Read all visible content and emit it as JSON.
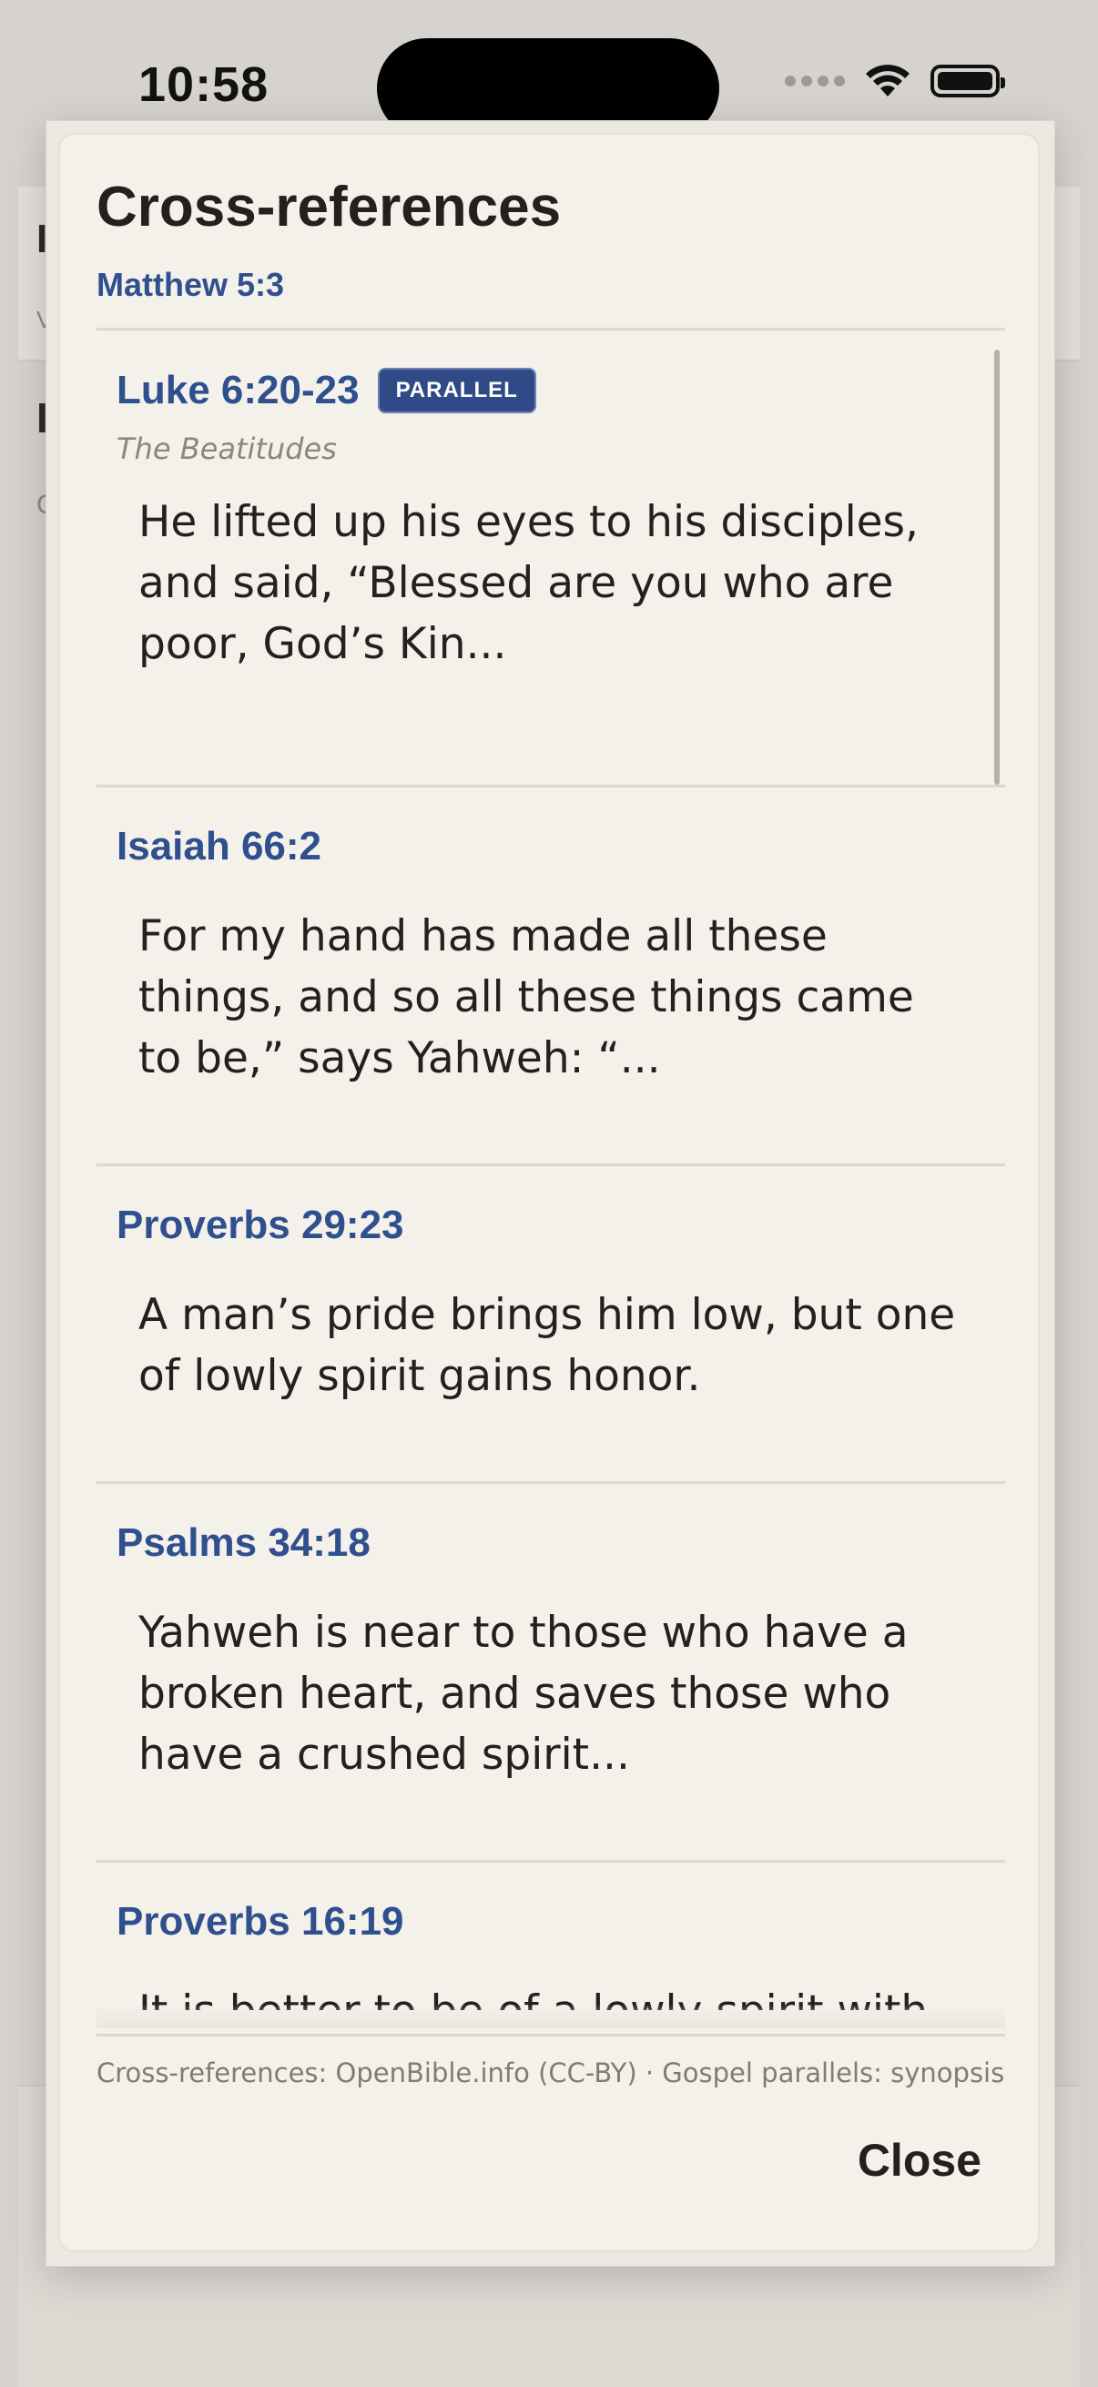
{
  "status_bar": {
    "time": "10:58"
  },
  "background": {
    "fragments": [
      "I",
      "V",
      "I",
      "C"
    ]
  },
  "sheet": {
    "title": "Cross-references",
    "source_reference": "Matthew 5:3",
    "items": [
      {
        "reference": "Luke 6:20-23",
        "badge": "PARALLEL",
        "subtitle": "The Beatitudes",
        "text": "He lifted up his eyes to his disciples, and said, “Blessed are you who are poor, God’s Kin..."
      },
      {
        "reference": "Isaiah 66:2",
        "text": "For my hand has made all these things, and so all these things came to be,” says Yahweh: “..."
      },
      {
        "reference": "Proverbs 29:23",
        "text": "A man’s pride brings him low, but one of lowly spirit gains honor."
      },
      {
        "reference": "Psalms 34:18",
        "text": "Yahweh is near to those who have a broken heart, and saves those who have a crushed spirit..."
      },
      {
        "reference": "Proverbs 16:19",
        "text": "It is better to be of a lowly spirit with"
      }
    ],
    "attribution": "Cross-references: OpenBible.info (CC-BY) · Gospel parallels: synopsis",
    "close_label": "Close"
  },
  "colors": {
    "accent": "#2f4f8e",
    "badge_bg": "#2f4a86",
    "sheet_bg": "#f4f1ea",
    "text": "#24201c"
  }
}
